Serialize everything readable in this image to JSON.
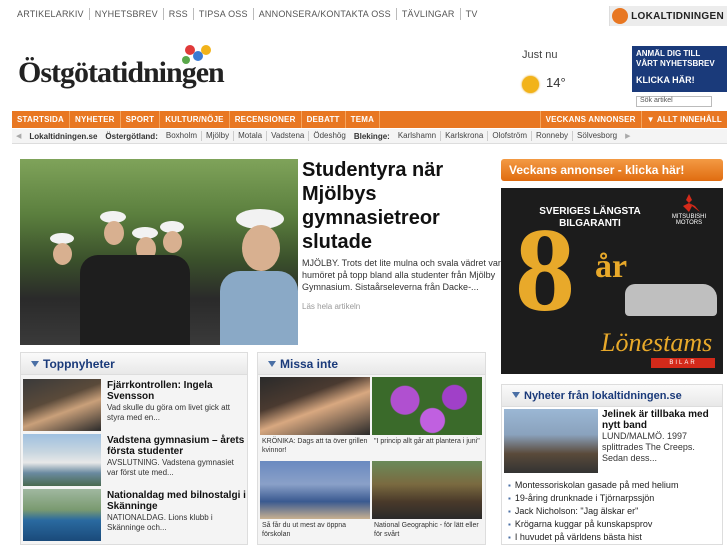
{
  "topbar": {
    "links": [
      "ARTIKELARKIV",
      "NYHETSBREV",
      "RSS",
      "TIPSA OSS",
      "ANNONSERA/KONTAKTA OSS",
      "TÄVLINGAR",
      "TV"
    ],
    "brand": "LOKALTIDNINGEN"
  },
  "header": {
    "masthead": "Östgötatidningen",
    "weather_label": "Just nu",
    "temperature": "14°",
    "newsletter_banner": {
      "line1": "ANMÄL DIG TILL",
      "line2": "VÅRT NYHETSBREV",
      "cta": "KLICKA HÄR!"
    },
    "search_placeholder": "Sök artikel"
  },
  "nav": {
    "items": [
      "STARTSIDA",
      "NYHETER",
      "SPORT",
      "KULTUR/NÖJE",
      "RECENSIONER",
      "DEBATT",
      "TEMA"
    ],
    "right_items": [
      "VECKANS ANNONSER",
      "▼ ALLT INNEHÅLL"
    ]
  },
  "subnav": {
    "lead": "Lokaltidningen.se",
    "region1": "Östergötland:",
    "region1_items": [
      "Boxholm",
      "Mjölby",
      "Motala",
      "Vadstena",
      "Ödeshög"
    ],
    "region2": "Blekinge:",
    "region2_items": [
      "Karlshamn",
      "Karlskrona",
      "Olofström",
      "Ronneby",
      "Sölvesborg"
    ]
  },
  "hero": {
    "title": "Studentyra när Mjölbys gymnasietreor slutade",
    "text": "MJÖLBY. Trots det lite mulna och svala vädret var humöret på topp bland alla studenter från Mjölby Gymnasium. Sistaårseleverna från Dacke-...",
    "more": "Läs hela artikeln"
  },
  "toppnyheter": {
    "title": "Toppnyheter",
    "items": [
      {
        "title": "Fjärrkontrollen: Ingela Svensson",
        "text": "Vad skulle du göra om livet gick att styra med en..."
      },
      {
        "title": "Vadstena gymnasium – årets första studenter",
        "text": "AVSLUTNING. Vadstena gymnasiet var först ute med..."
      },
      {
        "title": "Nationaldag med bilnostalgi i Skänninge",
        "text": "NATIONALDAG. Lions klubb i Skänninge och..."
      }
    ]
  },
  "missa": {
    "title": "Missa inte",
    "items": [
      {
        "caption": "KRÖNIKA: Dags att ta över grillen kvinnor!"
      },
      {
        "caption": "\"I princip allt går att plantera i juni\""
      },
      {
        "caption": "Så får du ut mest av öppna förskolan"
      },
      {
        "caption": "National Geographic - för lätt eller för svårt"
      }
    ]
  },
  "ads": {
    "header": "Veckans annonser - klicka här!",
    "slogan": "SVERIGES LÄNGSTA BILGARANTI",
    "big_number": "8",
    "big_unit": "år",
    "maker": "MITSUBISHI MOTORS",
    "dealer": "Lönestams",
    "dealer_sub": "BILAR"
  },
  "lokal": {
    "title": "Nyheter från lokaltidningen.se",
    "feature_title": "Jelinek är tillbaka med nytt band",
    "feature_text": "LUND/MALMÖ. 1997 splittrades The Creeps. Sedan dess...",
    "list": [
      "Montessoriskolan gasade på med helium",
      "19-åring drunknade i Tjörnarpssjön",
      "Jack Nicholson: \"Jag älskar er\"",
      "Krögarna kuggar på kunskapsprov",
      "I huvudet på världens bästa hist"
    ]
  },
  "colors": {
    "accent": "#e87722",
    "link": "#1a3a7a"
  }
}
